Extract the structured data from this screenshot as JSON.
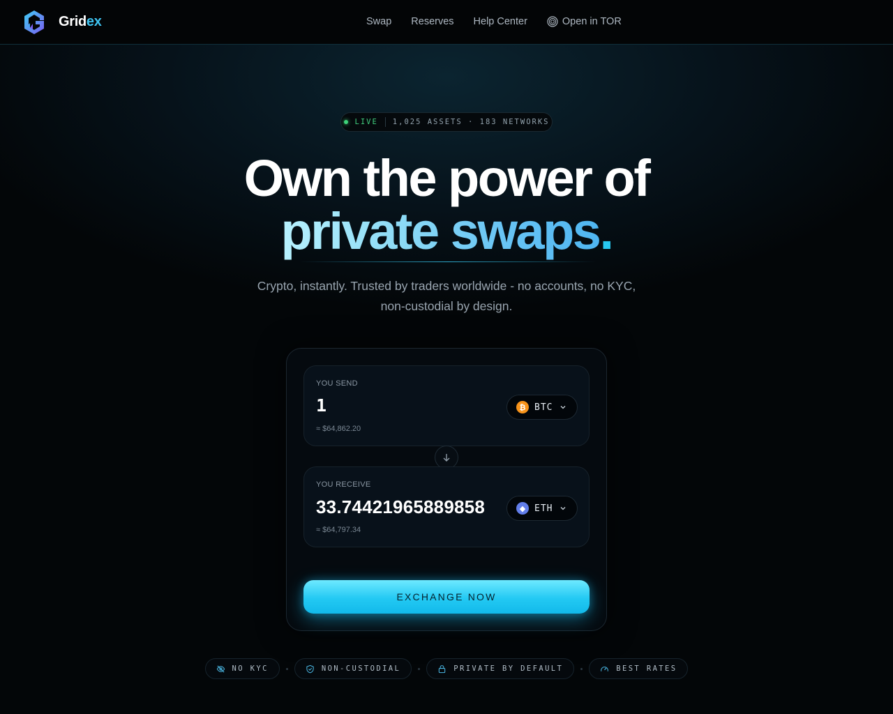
{
  "brand": {
    "name_part1": "Grid",
    "name_part2": "ex",
    "logo_icon": "gridex-logo-icon"
  },
  "nav": {
    "links": [
      "Swap",
      "Reserves",
      "Help Center"
    ],
    "tor_label": "Open in TOR",
    "tor_icon": "tor-onion-icon"
  },
  "hero": {
    "badge": {
      "live": "LIVE",
      "stats": "1,025 ASSETS · 183 NETWORKS"
    },
    "title_line1": "Own the power of",
    "title_line2": "private swaps",
    "title_dot": ".",
    "subtitle_line1": "Crypto, instantly. Trusted by traders worldwide - no accounts, no KYC,",
    "subtitle_line2": "non-custodial by design."
  },
  "swap": {
    "send": {
      "label": "YOU SEND",
      "amount": "1",
      "usd": "≈ $64,862.20",
      "token": "BTC",
      "token_glyph": "₿"
    },
    "receive": {
      "label": "YOU RECEIVE",
      "amount": "33.74421965889858",
      "usd": "≈ $64,797.34",
      "token": "ETH",
      "token_glyph": "◆"
    },
    "button": "EXCHANGE NOW"
  },
  "features": [
    {
      "label": "NO KYC",
      "icon": "eye-off-icon"
    },
    {
      "label": "NON-CUSTODIAL",
      "icon": "shield-check-icon"
    },
    {
      "label": "PRIVATE BY DEFAULT",
      "icon": "lock-icon"
    },
    {
      "label": "BEST RATES",
      "icon": "gauge-icon"
    }
  ],
  "colors": {
    "accent": "#27c8f0",
    "live": "#3ed27a",
    "btc": "#f7931a",
    "eth": "#627eea",
    "background": "#030608"
  }
}
